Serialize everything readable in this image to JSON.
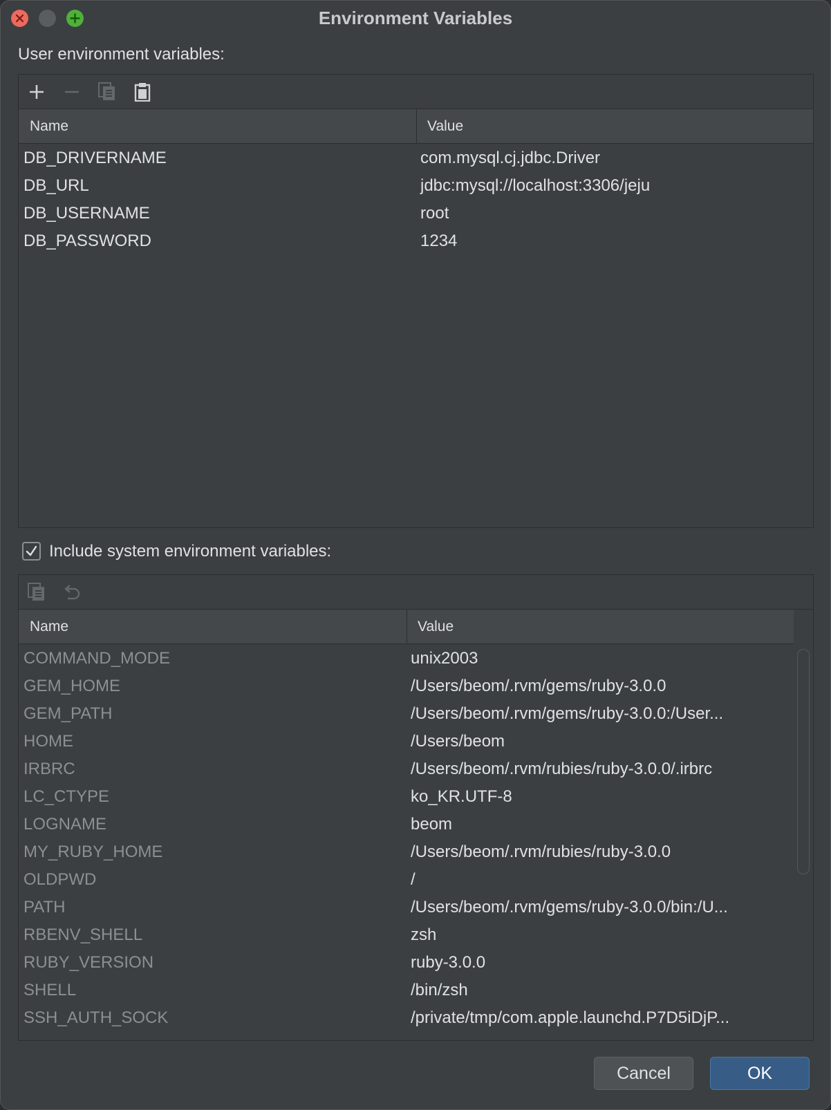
{
  "window": {
    "title": "Environment Variables"
  },
  "user_section": {
    "label": "User environment variables:",
    "toolbar": [
      "add-icon",
      "remove-icon",
      "copy-icon",
      "paste-icon"
    ],
    "columns": [
      "Name",
      "Value"
    ],
    "rows": [
      {
        "name": "DB_DRIVERNAME",
        "value": "com.mysql.cj.jdbc.Driver"
      },
      {
        "name": "DB_URL",
        "value": "jdbc:mysql://localhost:3306/jeju"
      },
      {
        "name": "DB_USERNAME",
        "value": "root"
      },
      {
        "name": "DB_PASSWORD",
        "value": "1234"
      }
    ]
  },
  "system_section": {
    "checkbox_label": "Include system environment variables:",
    "checked": true,
    "toolbar": [
      "copy-icon",
      "undo-icon"
    ],
    "columns": [
      "Name",
      "Value"
    ],
    "rows": [
      {
        "name": "COMMAND_MODE",
        "value": "unix2003"
      },
      {
        "name": "GEM_HOME",
        "value": "/Users/beom/.rvm/gems/ruby-3.0.0"
      },
      {
        "name": "GEM_PATH",
        "value": "/Users/beom/.rvm/gems/ruby-3.0.0:/User..."
      },
      {
        "name": "HOME",
        "value": "/Users/beom"
      },
      {
        "name": "IRBRC",
        "value": "/Users/beom/.rvm/rubies/ruby-3.0.0/.irbrc"
      },
      {
        "name": "LC_CTYPE",
        "value": "ko_KR.UTF-8"
      },
      {
        "name": "LOGNAME",
        "value": "beom"
      },
      {
        "name": "MY_RUBY_HOME",
        "value": "/Users/beom/.rvm/rubies/ruby-3.0.0"
      },
      {
        "name": "OLDPWD",
        "value": "/"
      },
      {
        "name": "PATH",
        "value": "/Users/beom/.rvm/gems/ruby-3.0.0/bin:/U..."
      },
      {
        "name": "RBENV_SHELL",
        "value": "zsh"
      },
      {
        "name": "RUBY_VERSION",
        "value": "ruby-3.0.0"
      },
      {
        "name": "SHELL",
        "value": "/bin/zsh"
      },
      {
        "name": "SSH_AUTH_SOCK",
        "value": "/private/tmp/com.apple.launchd.P7D5iDjP..."
      }
    ]
  },
  "buttons": {
    "cancel": "Cancel",
    "ok": "OK"
  }
}
